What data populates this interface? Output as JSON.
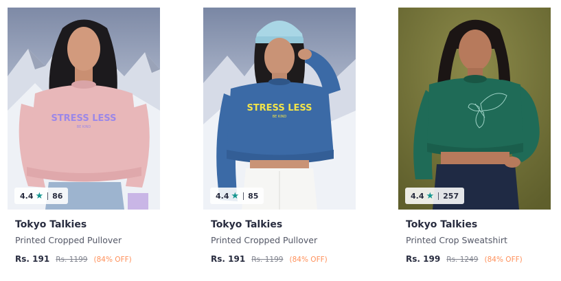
{
  "products": [
    {
      "brand": "Tokyo Talkies",
      "name": "Printed Cropped Pullover",
      "price": "Rs. 191",
      "mrp": "Rs. 1199",
      "discount": "(84% OFF)",
      "rating": "4.4",
      "rating_count": "86",
      "star_icon": "★",
      "garment_color": "#e8b7b9",
      "print_text_lines": [
        "STRESS LESS",
        "BE KIND"
      ],
      "print_color": "#9b87e8",
      "background": "snowy-mountains"
    },
    {
      "brand": "Tokyo Talkies",
      "name": "Printed Cropped Pullover",
      "price": "Rs. 191",
      "mrp": "Rs. 1199",
      "discount": "(84% OFF)",
      "rating": "4.4",
      "rating_count": "85",
      "star_icon": "★",
      "garment_color": "#3b6aa6",
      "print_text_lines": [
        "STRESS LESS",
        "BE KIND"
      ],
      "print_color": "#f2e44a",
      "background": "snowy-mountains"
    },
    {
      "brand": "Tokyo Talkies",
      "name": "Printed Crop Sweatshirt",
      "price": "Rs. 199",
      "mrp": "Rs. 1249",
      "discount": "(84% OFF)",
      "rating": "4.4",
      "rating_count": "257",
      "star_icon": "★",
      "garment_color": "#1f6b57",
      "print_text_lines": [],
      "print_color": "#9ed2c6",
      "background": "olive-studio"
    }
  ],
  "colors": {
    "rating_star": "#14958f",
    "discount": "#ff905a",
    "brand_text": "#282c3f"
  }
}
